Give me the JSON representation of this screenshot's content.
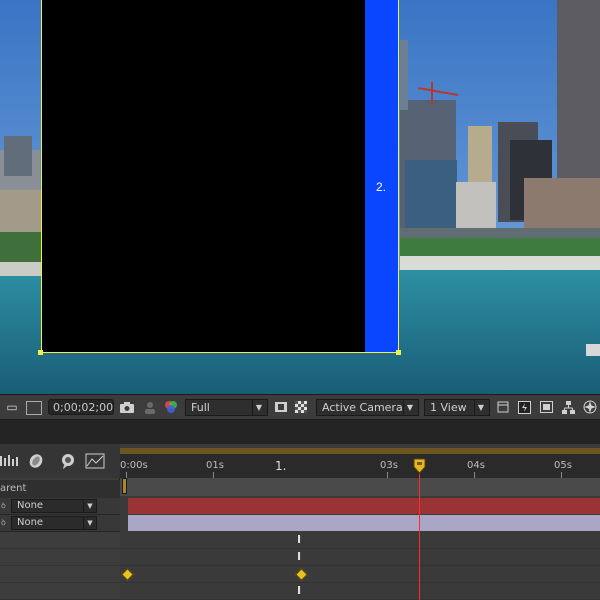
{
  "viewer": {
    "layer_label": "2."
  },
  "toolbar": {
    "timecode": "0;00;02;00",
    "resolution": "Full",
    "camera": "Active Camera",
    "view_layout": "1 View",
    "icons": [
      "region-of-interest-icon",
      "toggle-transparency-grid-icon",
      "snapshot-icon",
      "show-snapshot-icon",
      "color-channel-icon",
      "mask-visibility-icon",
      "checkerboard-icon",
      "fast-preview-icon",
      "pixel-aspect-icon",
      "flowchart-icon"
    ]
  },
  "timeline": {
    "parent_column_label": "arent",
    "layers": [
      {
        "parent": "None",
        "bar_color": "#9a3434"
      },
      {
        "parent": "None",
        "bar_color": "#aaa6c6"
      }
    ],
    "ruler": {
      "labels": [
        "0:00s",
        "01s",
        "03s",
        "04s",
        "05s"
      ],
      "marker": "1.",
      "playhead_seconds": 2
    }
  },
  "colors": {
    "layer_outline": "#f0f04a",
    "blue_solid": "#0a46ff",
    "playhead": "#ff2a2a",
    "keyframe": "#e6c12a"
  }
}
